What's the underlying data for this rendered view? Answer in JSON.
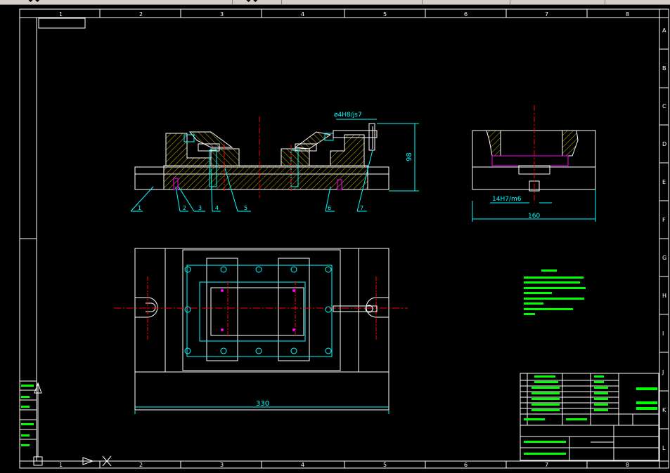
{
  "toolbar": {
    "panes": [
      "",
      "",
      ""
    ]
  },
  "drawing": {
    "border_columns": [
      "1",
      "2",
      "3",
      "4",
      "5",
      "6",
      "7",
      "8"
    ],
    "border_rows": [
      "A",
      "B",
      "C",
      "D",
      "E",
      "F",
      "G",
      "H",
      "I",
      "J",
      "K",
      "L"
    ],
    "dimensions": {
      "fit_label": "ø4H8/js7",
      "height_98": "98",
      "fit_side": "14H7/m6",
      "width_160": "160",
      "width_330": "330"
    },
    "balloons": [
      "1",
      "2",
      "3",
      "4",
      "5",
      "6",
      "7"
    ]
  },
  "colors": {
    "background": "#000000",
    "frame": "#ffffff",
    "outline": "#ffffff",
    "hatch": "#c8b400",
    "dimension": "#00ffff",
    "centerline": "#ff0000",
    "purple": "#ff00ff",
    "notes": "#00ff00"
  },
  "ucs_icon": "ucs-axis-icon"
}
